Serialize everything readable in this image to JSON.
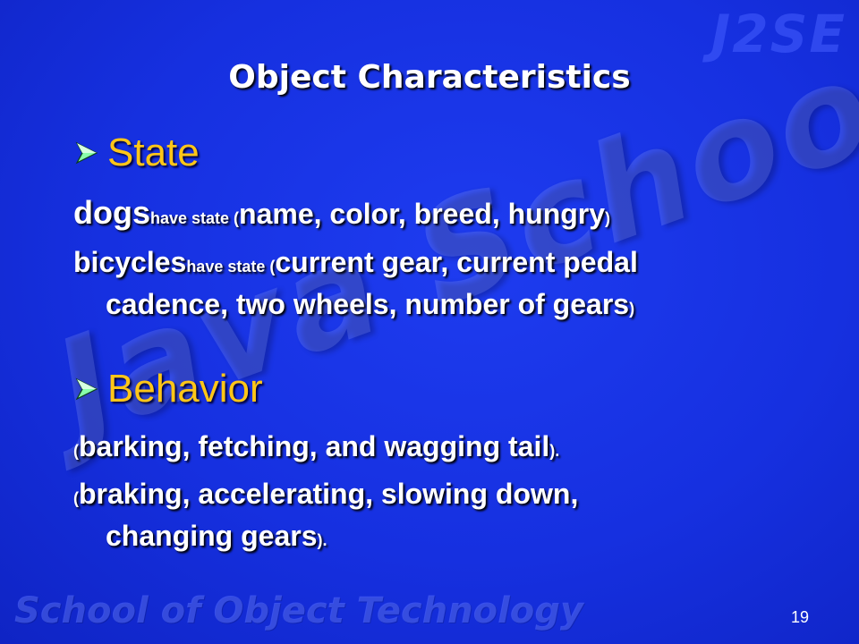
{
  "watermarks": {
    "corner": "J2SE",
    "footer": "School of Object Technology",
    "diagonal": "Java School"
  },
  "slide": {
    "title": "Object Characteristics",
    "state_heading": "State",
    "dogs": {
      "subject": "dogs",
      "mid": "have state (",
      "list": "name, color, breed, hungry",
      "end": ")"
    },
    "bicycles": {
      "subject": "bicycles",
      "mid": "have state (",
      "list_line1": "current gear, current pedal",
      "list_line2": "cadence, two wheels, number of gears",
      "end": ")"
    },
    "behavior_heading": "Behavior",
    "behavior1": {
      "open": "(",
      "text": "barking, fetching, and wagging tail",
      "close": ")."
    },
    "behavior2": {
      "open": "(",
      "text_line1": "braking, accelerating, slowing down,",
      "text_line2": "changing gears",
      "close": ")."
    },
    "page_number": "19"
  },
  "colors": {
    "background": "#1630e0",
    "heading": "#ffc618",
    "text": "#ffffff",
    "bullet_arrow": "#88ffaa"
  },
  "icons": {
    "bullet": "arrowhead-bullet-icon"
  }
}
